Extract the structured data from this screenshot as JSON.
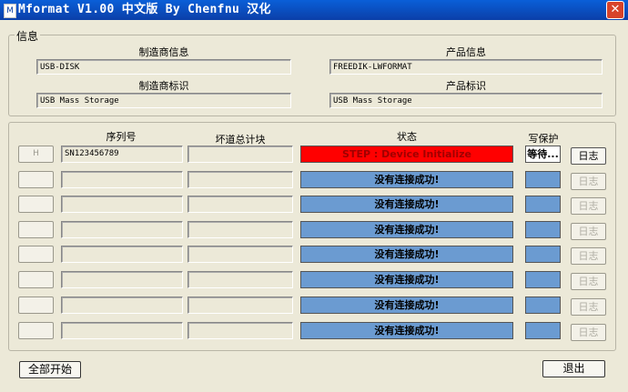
{
  "window": {
    "title": "Mformat V1.00 中文版 By Chenfnu 汉化",
    "icon": "app-icon",
    "close_glyph": "✕"
  },
  "info": {
    "group_label": "信息",
    "vendor_info_label": "制造商信息",
    "vendor_info_value": "USB-DISK",
    "vendor_id_label": "制造商标识",
    "vendor_id_value": "USB Mass Storage",
    "product_info_label": "产品信息",
    "product_info_value": "FREEDIK-LWFORMAT",
    "product_id_label": "产品标识",
    "product_id_value": "USB Mass Storage"
  },
  "table": {
    "headers": {
      "serial": "序列号",
      "bad_blocks": "坏道总计块",
      "status": "状态",
      "write_protect": "写保护"
    },
    "rows": [
      {
        "button": "H",
        "serial": "SN123456789",
        "bad_blocks": "",
        "status": "STEP : Device Initialize",
        "write_protect": "等待...",
        "log": "日志"
      },
      {
        "button": "",
        "serial": "",
        "bad_blocks": "",
        "status": "没有连接成功!",
        "write_protect": "",
        "log": "日志"
      },
      {
        "button": "",
        "serial": "",
        "bad_blocks": "",
        "status": "没有连接成功!",
        "write_protect": "",
        "log": "日志"
      },
      {
        "button": "",
        "serial": "",
        "bad_blocks": "",
        "status": "没有连接成功!",
        "write_protect": "",
        "log": "日志"
      },
      {
        "button": "",
        "serial": "",
        "bad_blocks": "",
        "status": "没有连接成功!",
        "write_protect": "",
        "log": "日志"
      },
      {
        "button": "",
        "serial": "",
        "bad_blocks": "",
        "status": "没有连接成功!",
        "write_protect": "",
        "log": "日志"
      },
      {
        "button": "",
        "serial": "",
        "bad_blocks": "",
        "status": "没有连接成功!",
        "write_protect": "",
        "log": "日志"
      },
      {
        "button": "",
        "serial": "",
        "bad_blocks": "",
        "status": "没有连接成功!",
        "write_protect": "",
        "log": "日志"
      }
    ]
  },
  "footer": {
    "start_all": "全部开始",
    "exit": "退出"
  },
  "colors": {
    "active_status": "#ff0000",
    "idle_status": "#6b9bd1",
    "titlebar": "#0b4fc0"
  }
}
